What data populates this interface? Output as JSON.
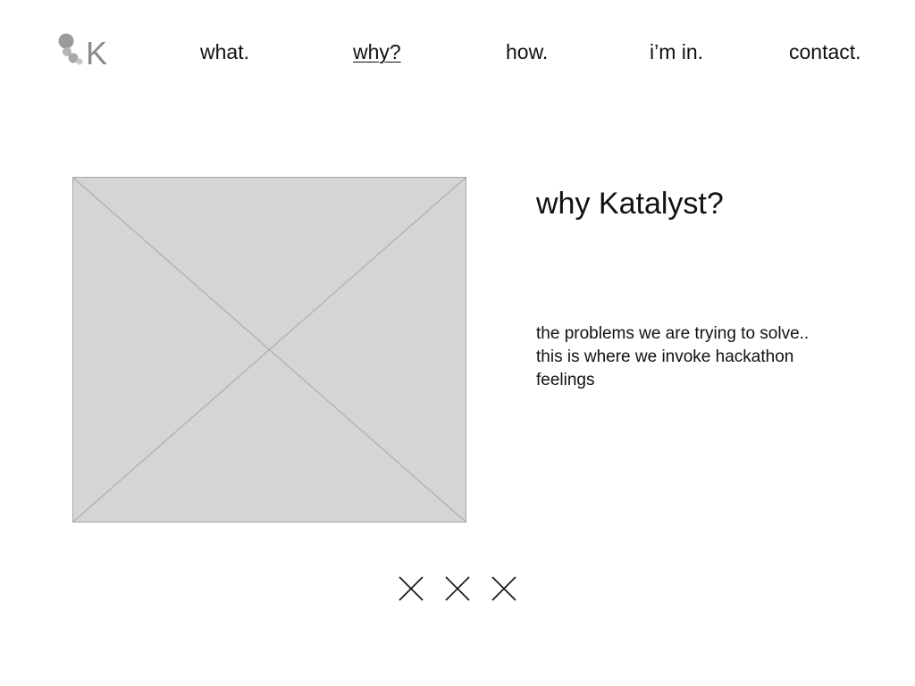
{
  "logo": {
    "letter": "K",
    "icon": "katalyst-logo-icon",
    "color": "#8a8a8a"
  },
  "nav": {
    "items": [
      {
        "label": "what.",
        "active": false
      },
      {
        "label": "why?",
        "active": true
      },
      {
        "label": "how.",
        "active": false
      },
      {
        "label": "i’m in.",
        "active": false
      },
      {
        "label": "contact.",
        "active": false
      }
    ]
  },
  "main": {
    "image_placeholder": {
      "icon": "image-placeholder-icon",
      "fill": "#d4d5d4",
      "stroke": "#a6a7a6"
    },
    "title": "why Katalyst?",
    "body_lines": [
      "the problems we are trying to solve..",
      "this is where we invoke hackathon",
      "feelings"
    ]
  },
  "pager": {
    "icon": "close-icon",
    "count": 3
  }
}
